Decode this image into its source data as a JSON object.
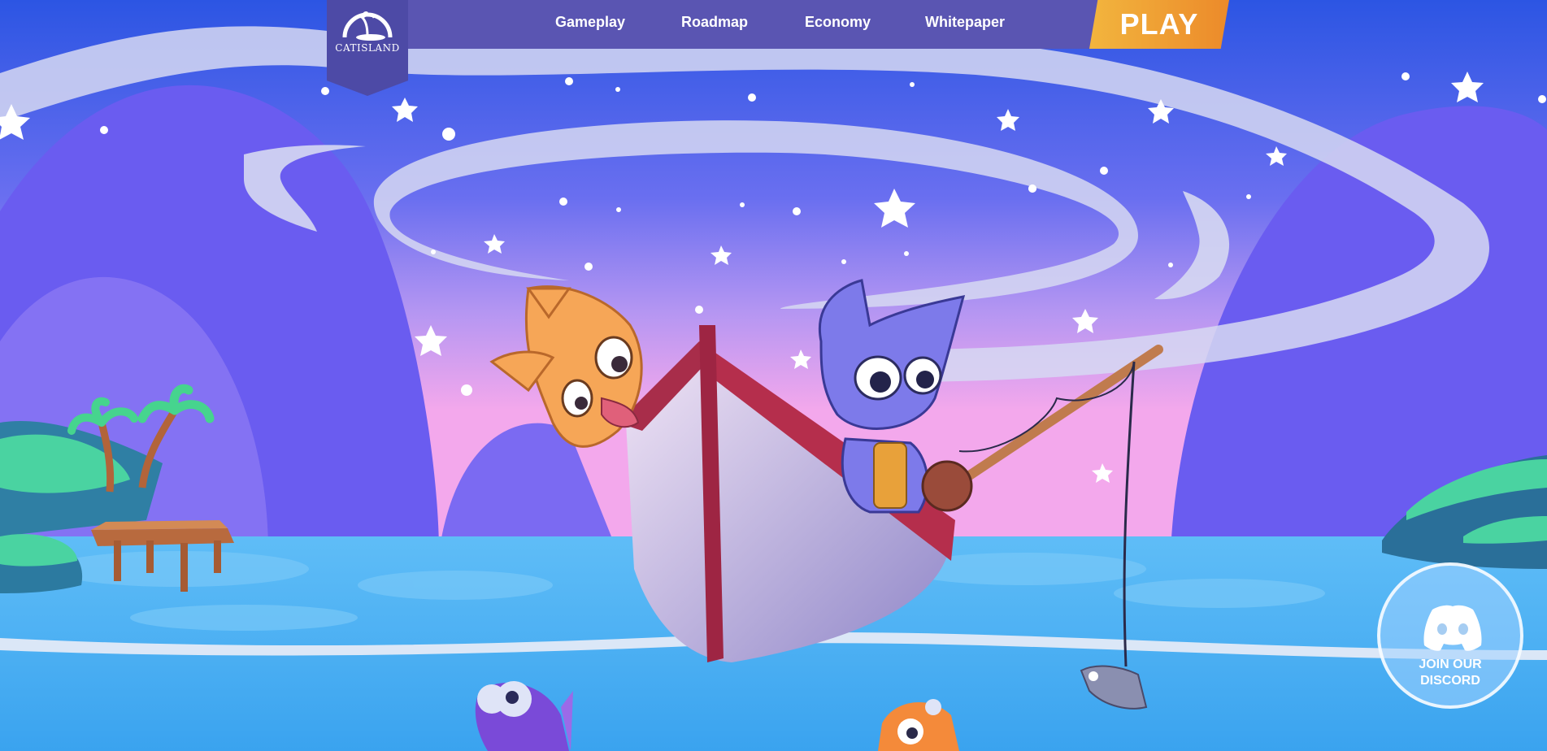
{
  "logo": {
    "text": "CATISLAND",
    "icon": "catisland-logo-icon"
  },
  "nav": {
    "items": [
      {
        "label": "Gameplay"
      },
      {
        "label": "Roadmap"
      },
      {
        "label": "Economy"
      },
      {
        "label": "Whitepaper"
      }
    ],
    "play_label": "PLAY"
  },
  "discord": {
    "label": "JOIN OUR\nDISCORD",
    "icon": "discord-icon"
  },
  "colors": {
    "nav_bg": "#5a55b2",
    "play_gradient_start": "#f2b53e",
    "play_gradient_end": "#ec8a2a",
    "sky_top": "#2f56e2",
    "sky_pink": "#f0a8ee",
    "water": "#4bb3f5"
  }
}
